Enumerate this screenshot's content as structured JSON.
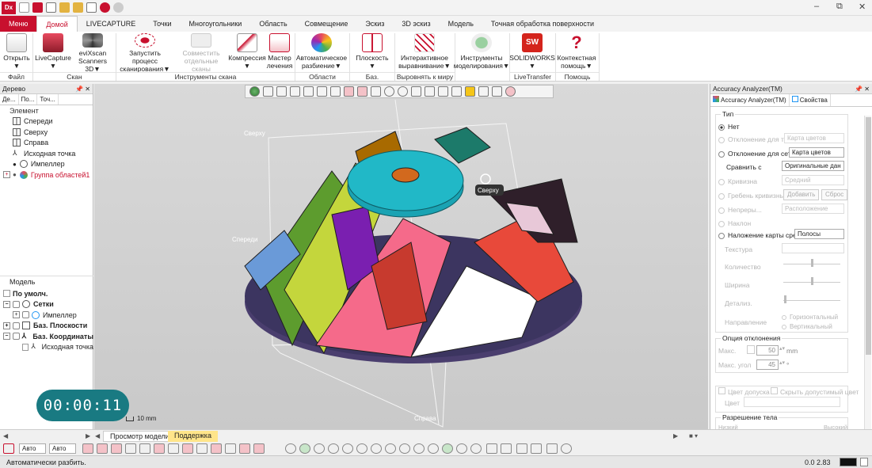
{
  "titlebar": {
    "logo": "Dx",
    "window_controls": [
      "–",
      "⧉",
      "✕"
    ]
  },
  "tabs": [
    "Меню",
    "Домой",
    "LIVECAPTURE",
    "Точки",
    "Многоугольники",
    "Область",
    "Совмещение",
    "Эскиз",
    "3D эскиз",
    "Модель",
    "Точная обработка поверхности"
  ],
  "ribbon": {
    "buttons": [
      {
        "label": "Открыть",
        "sub": "▼"
      },
      {
        "label": "LiveCapture",
        "sub": "▼"
      },
      {
        "label": "eviXscan",
        "sub": "Scanners 3D▼"
      },
      {
        "label": "Запустить процесс",
        "sub": "сканирования▼"
      },
      {
        "label": "Совместить",
        "sub": "отдельные сканы"
      },
      {
        "label": "Компрессия",
        "sub": "▼"
      },
      {
        "label": "Мастер",
        "sub": "лечения"
      },
      {
        "label": "Автоматическое",
        "sub": "разбиение▼"
      },
      {
        "label": "Плоскость",
        "sub": "▼"
      },
      {
        "label": "Интерактивное",
        "sub": "выравнивание▼"
      },
      {
        "label": "Инструменты",
        "sub": "моделирования▼"
      },
      {
        "label": "SOLIDWORKS",
        "sub": "▼"
      },
      {
        "label": "Контекстная",
        "sub": "помощь▼"
      }
    ],
    "groups": [
      "Файл",
      "Скан",
      "Инструменты скана",
      "Области",
      "Баз. геометрия",
      "Выровнять к миру",
      "LiveTransfer",
      "Помощь"
    ]
  },
  "left_panel": {
    "title": "Дерево",
    "subtabs": [
      "Де...",
      "По...",
      "Точ..."
    ],
    "element_header": "Элемент",
    "elements": [
      "Спереди",
      "Сверху",
      "Справа",
      "Исходная точка",
      "Импеллер",
      "Группа областей1"
    ],
    "model_header": "Модель",
    "model_items": [
      "По умолч.",
      "Сетки",
      "Импеллер",
      "Баз. Плоскости",
      "Баз. Координаты",
      "Исходная точка"
    ]
  },
  "viewport": {
    "labels": {
      "top": "Сверху",
      "front": "Спереди",
      "right": "Справа",
      "cursor": "Сверху"
    },
    "scale": "10 mm"
  },
  "right_panel": {
    "title": "Accuracy Analyzer(TM)",
    "tabs": [
      "Accuracy Analyzer(TM)",
      "Свойства"
    ],
    "type_label": "Тип",
    "options": {
      "none": "Нет",
      "body_dev": "Отклонение для тела",
      "body_dev_dd": "Карта цветов",
      "mesh_dev": "Отклонение для сетки",
      "mesh_dev_dd": "Карта цветов",
      "compare": "Сравнить с",
      "compare_dd": "Оригинальные дан",
      "curvature": "Кривизна",
      "curvature_dd": "Средний",
      "ridge": "Гребень кривизны",
      "add": "Добавить",
      "reset": "Сброс",
      "cont": "Непреры...",
      "cont_dd": "Расположение",
      "draft": "Наклон",
      "overlay": "Наложение карты среды",
      "overlay_dd": "Полосы",
      "texture": "Текстура",
      "count": "Количество",
      "width": "Ширина",
      "detail": "Детализ.",
      "direction": "Направление",
      "horiz": "Горизонтальный",
      "vert": "Вертикальный"
    },
    "deviation": {
      "title": "Опция отклонения",
      "max": "Макс.",
      "max_val": "50",
      "max_unit": "mm",
      "max_angle": "Макс. угол",
      "angle_val": "45",
      "angle_unit": "°"
    },
    "tolerance_color": "Цвет допуска",
    "hide_tol": "Скрыть допустимый цвет",
    "color": "Цвет",
    "resolution": {
      "title": "Разрешение тела",
      "low": "Низкий",
      "high": "Высокий"
    }
  },
  "bottom": {
    "auto1": "Авто",
    "auto2": "Авто",
    "tabs": [
      "Просмотр модели",
      "Поддержка"
    ]
  },
  "status": {
    "text": "Автоматически разбить.",
    "right": "0.0 2.83"
  },
  "timer": "00:00:11"
}
